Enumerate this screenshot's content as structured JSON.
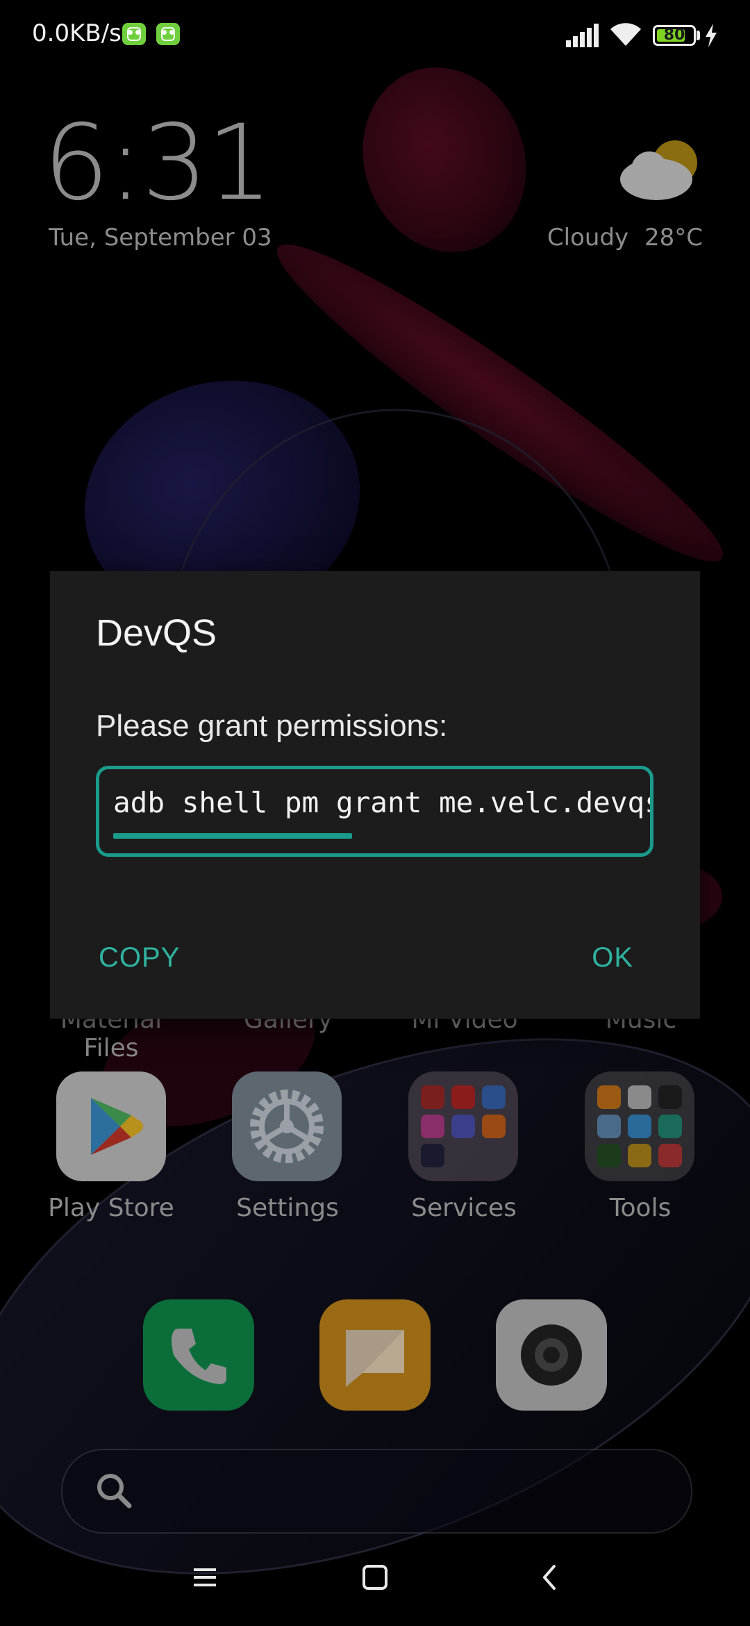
{
  "status_bar": {
    "net_speed": "0.0KB/s",
    "battery_level": "80",
    "battery_fraction": 0.8,
    "signal_icon": "signal-bars-icon",
    "wifi_icon": "wifi-icon",
    "charging_icon": "charging-bolt-icon"
  },
  "clock_widget": {
    "time": "6:31",
    "date": "Tue, September 03",
    "weather": "Cloudy  28°C",
    "weather_icon": "cloudy-sun-icon"
  },
  "home": {
    "row1_labels": [
      "Material Files",
      "Gallery",
      "Mi Video",
      "Music"
    ],
    "row2_apps": [
      {
        "label": "Play Store",
        "icon": "play-store-icon"
      },
      {
        "label": "Settings",
        "icon": "settings-gear-icon"
      },
      {
        "label": "Services",
        "icon": "folder-icon"
      },
      {
        "label": "Tools",
        "icon": "folder-icon"
      }
    ],
    "dock": [
      {
        "icon": "phone-icon"
      },
      {
        "icon": "messages-icon"
      },
      {
        "icon": "camera-icon"
      }
    ],
    "search_icon": "search-icon"
  },
  "dialog": {
    "title": "DevQS",
    "message": "Please grant permissions:",
    "command": "adb shell pm grant me.velc.devqs android.permission.WRITE_SECURE_SETTINGS",
    "copy_label": "COPY",
    "ok_label": "OK"
  },
  "navigation": {
    "menu_icon": "menu-icon",
    "home_icon": "home-square-icon",
    "back_icon": "back-chevron-icon"
  },
  "colors": {
    "accent": "#1a9b8c",
    "button_text": "#2fb3a0",
    "dialog_bg": "#1c1c1c",
    "battery_fill": "#7ed321"
  }
}
